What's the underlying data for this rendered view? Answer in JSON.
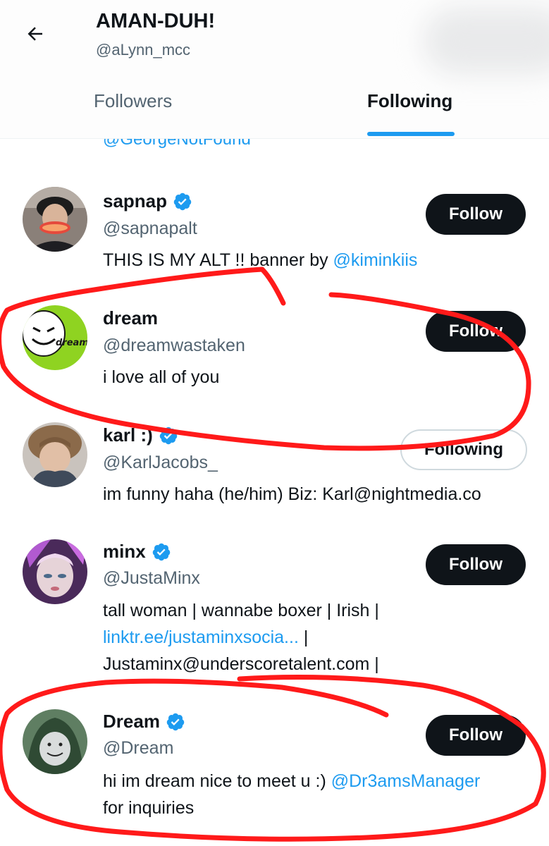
{
  "header": {
    "title": "AMAN-DUH!",
    "handle": "@aLynn_mcc"
  },
  "tabs": [
    {
      "label": "Followers",
      "active": false
    },
    {
      "label": "Following",
      "active": true
    }
  ],
  "partial_handle": "@GeorgeNotFound",
  "users": [
    {
      "name": "sapnap",
      "verified": true,
      "handle": "@sapnapalt",
      "bio_text": "THIS IS MY ALT !! banner by ",
      "bio_link": "@kiminkiis",
      "button": "Follow"
    },
    {
      "name": "dream",
      "verified": false,
      "handle": "@dreamwastaken",
      "bio_text": "i love all of you",
      "button": "Follow",
      "avatar_label": "dream"
    },
    {
      "name": "karl :)",
      "verified": true,
      "handle": "@KarlJacobs_",
      "bio_text": "im funny haha (he/him) Biz: Karl@nightmedia.co",
      "button": "Following"
    },
    {
      "name": "minx",
      "verified": true,
      "handle": "@JustaMinx",
      "bio_line1": "tall woman | wannabe boxer | Irish |",
      "bio_link": "linktr.ee/justaminxsocia...",
      "bio_after_link": " |",
      "bio_line3": "Justaminx@underscoretalent.com |",
      "button": "Follow"
    },
    {
      "name": "Dream",
      "verified": true,
      "handle": "@Dream",
      "bio_text": "hi im dream nice to meet u :) ",
      "bio_link": "@Dr3amsManager",
      "bio_line2": "for inquiries",
      "button": "Follow"
    }
  ],
  "colors": {
    "accent": "#1d9bf0",
    "button_dark": "#0f1419",
    "secondary_text": "#536471",
    "annotation": "#ff1a1a"
  }
}
